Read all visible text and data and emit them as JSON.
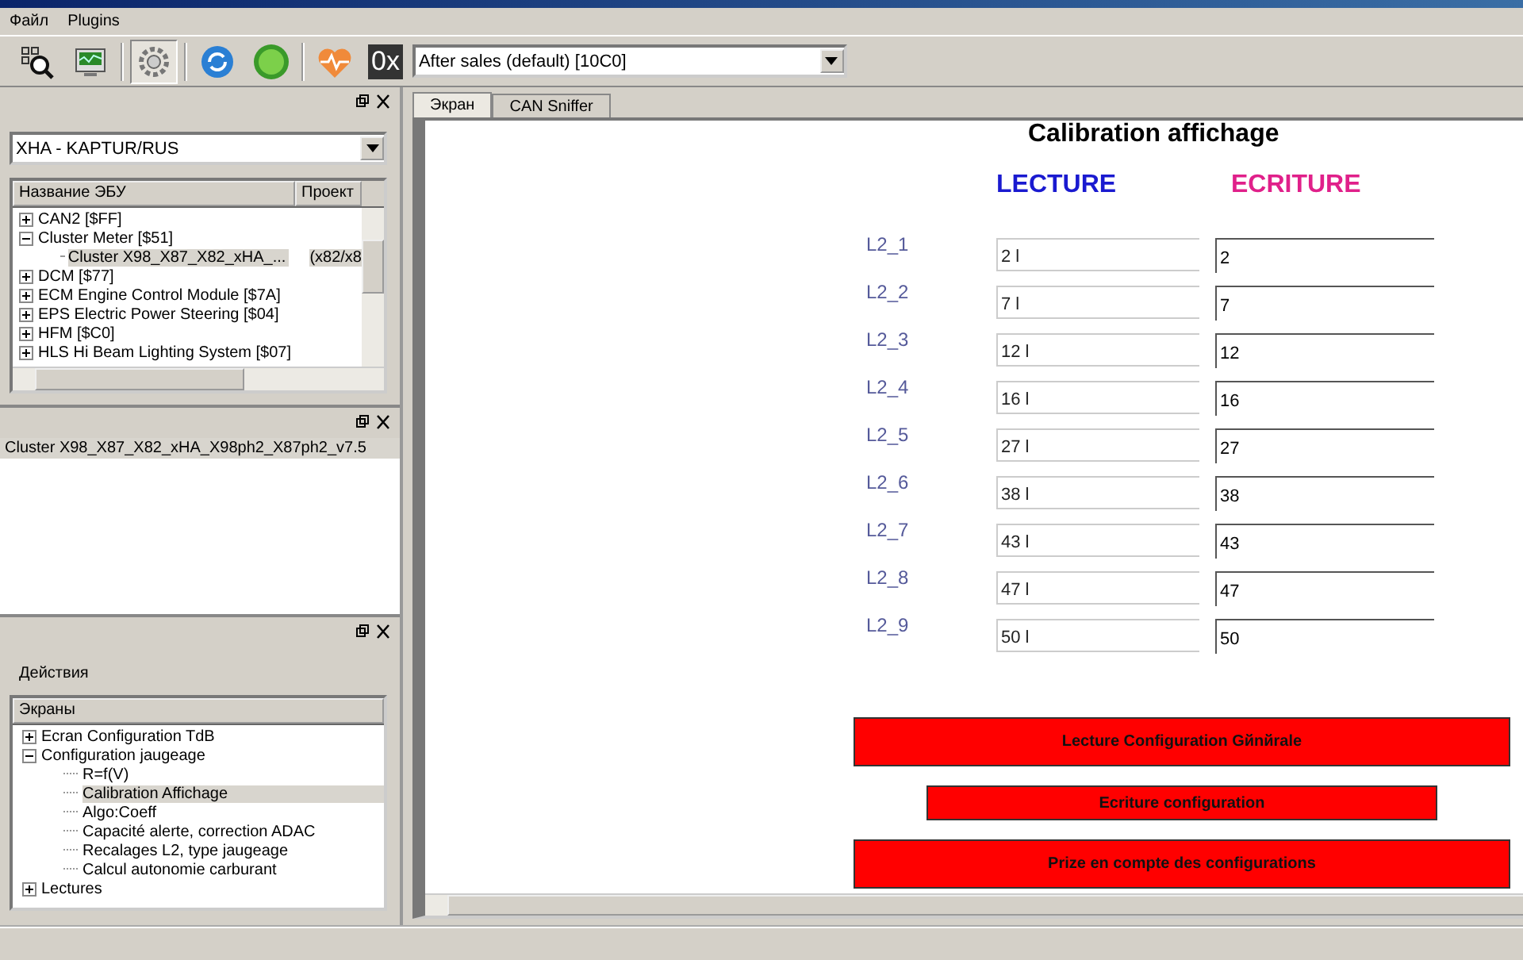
{
  "menu": [
    "Файл",
    "Plugins"
  ],
  "toolbar": {
    "buttons": [
      {
        "kind": "scan",
        "pressed": false
      },
      {
        "kind": "monitor",
        "pressed": false
      },
      {
        "kind": "gear",
        "pressed": true
      },
      {
        "kind": "refresh",
        "pressed": false
      },
      {
        "kind": "go",
        "pressed": false
      },
      {
        "kind": "heart",
        "pressed": false
      }
    ],
    "hex_label": "0x",
    "mode": "After sales (default) [10C0]"
  },
  "ecu_panel": {
    "vehicle": "XHA - KAPTUR/RUS",
    "columns": [
      "Название ЭБУ",
      "Проект"
    ],
    "tree": [
      {
        "label": "CAN2 [$FF]",
        "expanded": false
      },
      {
        "label": "Cluster Meter [$51]",
        "expanded": true,
        "children": [
          {
            "label": "Cluster X98_X87_X82_xHA_...",
            "column_2": "(x82/x8",
            "selected": true
          }
        ]
      },
      {
        "label": "DCM [$77]",
        "expanded": false
      },
      {
        "label": "ECM Engine Control Module [$7A]",
        "expanded": false
      },
      {
        "label": "EPS Electric Power Steering [$04]",
        "expanded": false
      },
      {
        "label": "HFM [$C0]",
        "expanded": false
      },
      {
        "label": "HLS Hi Beam Lighting System [$07]",
        "expanded": false
      }
    ]
  },
  "variant_panel": {
    "items": [
      {
        "label": "Cluster X98_X87_X82_xHA_X98ph2_X87ph2_v7.5",
        "selected": true
      }
    ]
  },
  "actions_panel": {
    "title": "Действия",
    "header": "Экраны",
    "tree": [
      {
        "label": "Ecran Configuration TdB",
        "expanded": false
      },
      {
        "label": "Configuration jaugeage",
        "expanded": true,
        "children": [
          {
            "label": "R=f(V)",
            "selected": false
          },
          {
            "label": "Calibration Affichage",
            "selected": true
          },
          {
            "label": "Algo:Coeff",
            "selected": false
          },
          {
            "label": "Capacité alerte, correction ADAC",
            "selected": false
          },
          {
            "label": "Recalages L2, type jaugeage",
            "selected": false
          },
          {
            "label": "Calcul autonomie carburant",
            "selected": false
          }
        ]
      },
      {
        "label": "Lectures",
        "expanded": false
      }
    ]
  },
  "tabs": [
    {
      "label": "Экран",
      "selected": true
    },
    {
      "label": "CAN Sniffer",
      "selected": false
    }
  ],
  "screen": {
    "title": "Calibration affichage",
    "read_header": "LECTURE",
    "write_header": "ECRITURE",
    "rows": [
      {
        "label": "L2_1",
        "read": "2 l",
        "write": "2"
      },
      {
        "label": "L2_2",
        "read": "7 l",
        "write": "7"
      },
      {
        "label": "L2_3",
        "read": "12 l",
        "write": "12"
      },
      {
        "label": "L2_4",
        "read": "16 l",
        "write": "16"
      },
      {
        "label": "L2_5",
        "read": "27 l",
        "write": "27"
      },
      {
        "label": "L2_6",
        "read": "38 l",
        "write": "38"
      },
      {
        "label": "L2_7",
        "read": "43 l",
        "write": "43"
      },
      {
        "label": "L2_8",
        "read": "47 l",
        "write": "47"
      },
      {
        "label": "L2_9",
        "read": "50 l",
        "write": "50"
      }
    ],
    "buttons": [
      {
        "label": "Lecture Configuration Gйnйrale",
        "kind": "wide"
      },
      {
        "label": "Ecriture configuration",
        "kind": "narrow"
      },
      {
        "label": "Prize en compte des configurations",
        "kind": "wide"
      }
    ]
  }
}
